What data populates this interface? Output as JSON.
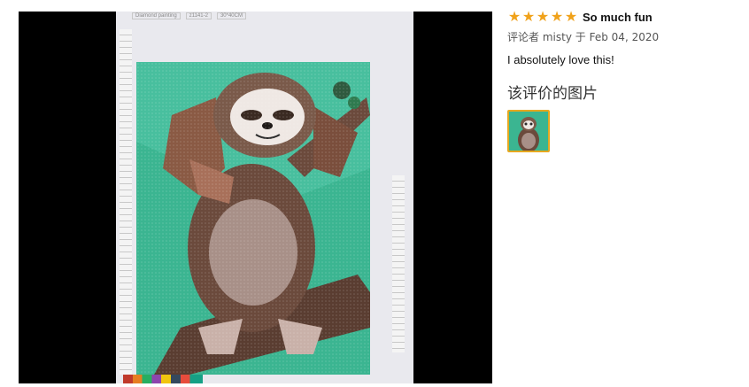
{
  "review": {
    "rating_stars": 5,
    "title": "So much fun",
    "reviewer_prefix": "评论者",
    "reviewer_name": "misty",
    "date_prefix": "于",
    "date": "Feb 04, 2020",
    "body": "I absolutely love this!"
  },
  "images_section": {
    "heading": "该评价的图片"
  },
  "photo": {
    "header_brand": "Diamond painting",
    "header_code": "z1141-2",
    "header_size": "30*40CM"
  },
  "colors": {
    "star": "#f0a21b",
    "thumb_border": "#e6a81f",
    "viewer_bg": "#000000",
    "canvas_green": "#3bb591",
    "sloth_brown": "#6b4a3c"
  },
  "icons": {
    "star": "star-icon"
  }
}
